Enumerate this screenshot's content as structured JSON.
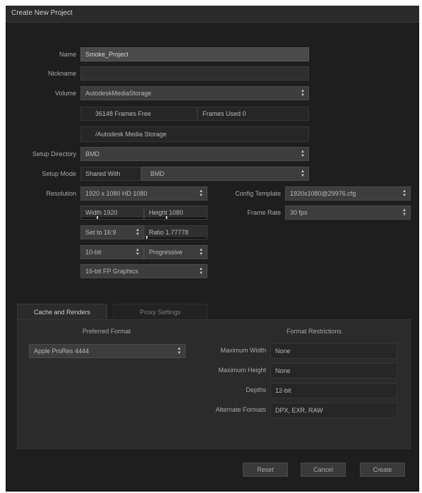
{
  "dialog": {
    "title": "Create New Project"
  },
  "form": {
    "name": {
      "label": "Name",
      "value": "Smoke_Project"
    },
    "nickname": {
      "label": "Nickname",
      "value": ""
    },
    "volume": {
      "label": "Volume",
      "value": "AutodeskMediaStorage",
      "frames_free": "36148 Frames Free",
      "frames_used": "Frames Used 0",
      "path": "/Autodesk Media Storage"
    },
    "setup_directory": {
      "label": "Setup Directory",
      "value": "BMD"
    },
    "setup_mode": {
      "label": "Setup Mode",
      "mode": "Shared With",
      "value": "BMD"
    },
    "resolution": {
      "label": "Resolution",
      "value": "1920 x 1080 HD 1080",
      "width": "Width 1920",
      "height": "Height 1080",
      "set_to": "Set to 16:9",
      "ratio": "Ratio 1.77778",
      "bit_depth": "10-bit",
      "scan": "Progressive",
      "graphics": "16-bit FP Graphics"
    },
    "config_template": {
      "label": "Config Template",
      "value": "1920x1080@29976.cfg"
    },
    "frame_rate": {
      "label": "Frame Rate",
      "value": "30 fps"
    }
  },
  "tabs": [
    {
      "label": "Cache and Renders",
      "active": true
    },
    {
      "label": "Proxy Settings",
      "active": false
    }
  ],
  "cache": {
    "preferred_format_header": "Preferred Format",
    "preferred_format": "Apple ProRes 4444",
    "restrictions_header": "Format Restrictions",
    "max_width": {
      "label": "Maximum Width",
      "value": "None"
    },
    "max_height": {
      "label": "Maximum Height",
      "value": "None"
    },
    "depths": {
      "label": "Depths",
      "value": "12-bit"
    },
    "alternate_formats": {
      "label": "Alternate Formats",
      "value": "DPX, EXR, RAW"
    }
  },
  "buttons": {
    "reset": "Reset",
    "cancel": "Cancel",
    "create": "Create"
  },
  "colors": {
    "window_bg": "#1e1e1e",
    "field_bg": "#2f2f2f",
    "active_field_bg": "#4a4a4a"
  }
}
